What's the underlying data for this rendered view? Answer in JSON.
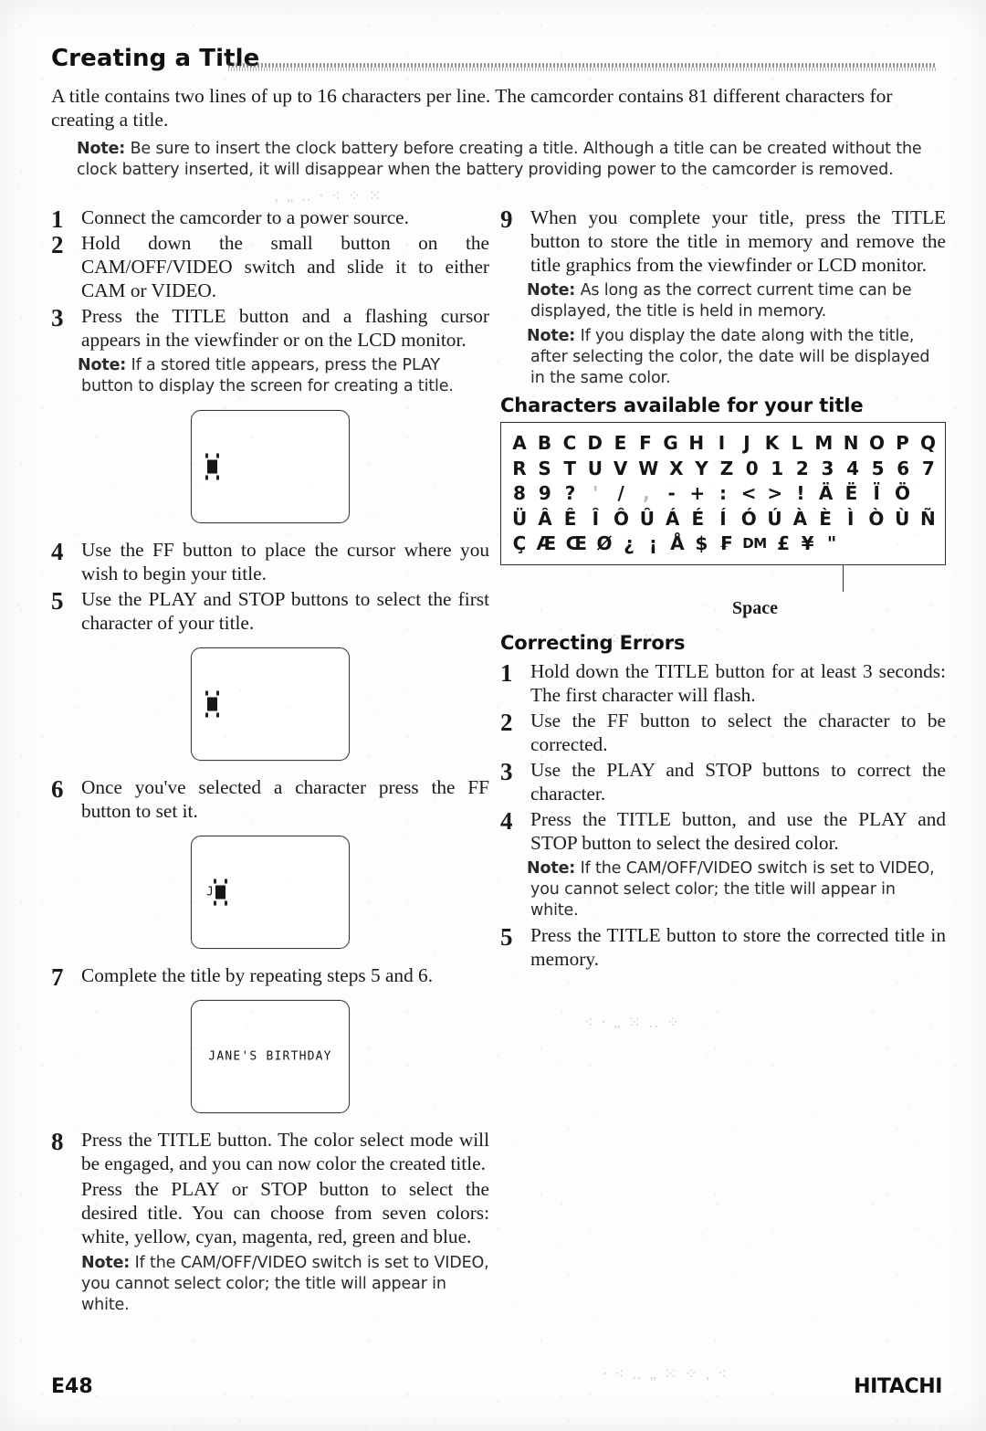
{
  "document": {
    "section_title": "Creating a Title",
    "intro": "A title contains two lines of up to 16 characters per line.  The camcorder contains 81 different characters for creating a title.",
    "intro_note_label": "Note:",
    "intro_note_text": "Be sure to insert the clock battery before creating a title. Although a title can be created without the clock battery inserted, it will disappear when the battery providing power to the camcorder is removed."
  },
  "left_column": {
    "steps": [
      {
        "num": "1",
        "text": "Connect the camcorder to a power source."
      },
      {
        "num": "2",
        "text": "Hold down the small button on the CAM/OFF/VIDEO switch and slide it to either CAM or VIDEO."
      },
      {
        "num": "3",
        "text": "Press the TITLE button and a flashing cursor appears in the viewfinder or on the LCD monitor.",
        "note_label": "Note:",
        "note_text": "If a stored title appears, press the PLAY button to display the screen for creating a title."
      },
      {
        "num": "4",
        "text": "Use the FF button to place the cursor where you wish to begin your title."
      },
      {
        "num": "5",
        "text": "Use the PLAY and STOP buttons to select the first character of your title."
      },
      {
        "num": "6",
        "text": "Once you've selected a character press the FF button to set it."
      },
      {
        "num": "7",
        "text": "Complete the title by repeating steps 5 and 6."
      },
      {
        "num": "8",
        "text": "Press the TITLE button.  The color select mode will be engaged, and you can now color the created title.",
        "extra_paragraph": "Press the PLAY or STOP button to select the desired title. You can choose from seven colors: white, yellow, cyan, magenta, red, green and blue.",
        "note_label": "Note:",
        "note_text": "If the CAM/OFF/VIDEO switch is set to VIDEO, you cannot select color; the title will appear in white."
      }
    ],
    "screens": [
      {
        "name": "screen-cursor-empty",
        "prefix": "",
        "has_cursor": true,
        "centered": false
      },
      {
        "name": "screen-cursor-second",
        "prefix": "",
        "has_cursor": true,
        "centered": false
      },
      {
        "name": "screen-letter-j",
        "prefix": "J",
        "has_cursor": true,
        "centered": false
      },
      {
        "name": "screen-completed-title",
        "prefix": "JANE'S BIRTHDAY",
        "has_cursor": false,
        "centered": true
      }
    ]
  },
  "right_column": {
    "steps": [
      {
        "num": "9",
        "text": "When you complete your title, press the TITLE button to store the title in memory and remove the title graphics from the viewfinder or LCD monitor.",
        "note_label": "Note:",
        "note_text": "As long as the correct current time can be displayed, the title is held in memory.",
        "note2_label": "Note:",
        "note2_text": "If you display the date along with the title, after selecting the color, the date will be displayed in the same color."
      }
    ],
    "characters_heading": "Characters available for your title",
    "char_rows": [
      [
        "A",
        "B",
        "C",
        "D",
        "E",
        "F",
        "G",
        "H",
        "I",
        "J",
        "K",
        "L",
        "M",
        "N",
        "O",
        "P",
        "Q"
      ],
      [
        "R",
        "S",
        "T",
        "U",
        "V",
        "W",
        "X",
        "Y",
        "Z",
        "0",
        "1",
        "2",
        "3",
        "4",
        "5",
        "6",
        "7"
      ],
      [
        "8",
        "9",
        "?",
        "'",
        "/",
        ",",
        "-",
        "+",
        ":",
        "<",
        ">",
        "!",
        "Ä",
        "Ë",
        "Ï",
        "Ö"
      ],
      [
        "Ü",
        "Â",
        "Ê",
        "Î",
        "Ô",
        "Û",
        "Á",
        "É",
        "Í",
        "Ó",
        "Ú",
        "À",
        "È",
        "Ì",
        "Ò",
        "Ù",
        "Ñ"
      ],
      [
        "Ç",
        "Æ",
        "Œ",
        "Ø",
        "¿",
        "¡",
        "Å",
        "$",
        "₣",
        "DM",
        "£",
        "¥",
        "\""
      ]
    ],
    "space_label": "Space",
    "correcting_heading": "Correcting Errors",
    "correcting_steps": [
      {
        "num": "1",
        "text": "Hold down the TITLE button for at least 3 seconds: The first character will flash."
      },
      {
        "num": "2",
        "text": "Use the FF button to select the character to be corrected."
      },
      {
        "num": "3",
        "text": "Use the PLAY and STOP buttons to correct the character."
      },
      {
        "num": "4",
        "text": "Press the TITLE button, and use the PLAY and STOP button to select the desired color.",
        "note_label": "Note:",
        "note_text": "If the CAM/OFF/VIDEO switch is set to VIDEO, you cannot select color; the title will appear in white."
      },
      {
        "num": "5",
        "text": "Press the TITLE button to store the corrected title in memory."
      }
    ]
  },
  "footer": {
    "page_number": "E48",
    "brand": "HITACHI"
  }
}
